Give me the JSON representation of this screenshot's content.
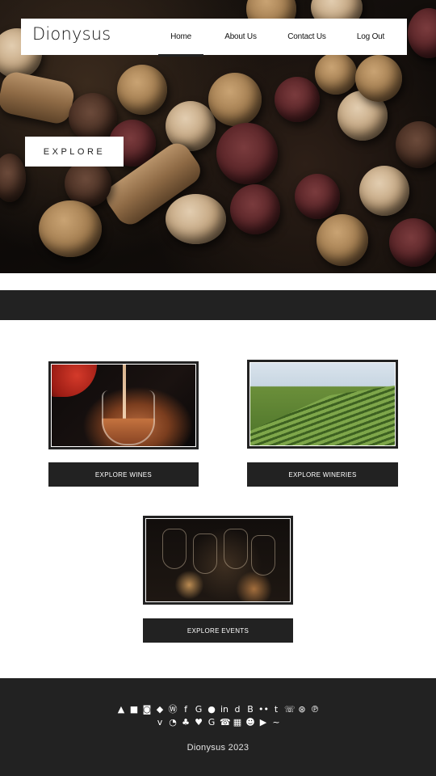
{
  "brand": {
    "name": "Dionysus"
  },
  "nav": [
    {
      "label": "Home",
      "active": true
    },
    {
      "label": "About Us",
      "active": false
    },
    {
      "label": "Contact Us",
      "active": false
    },
    {
      "label": "Log Out",
      "active": false
    }
  ],
  "hero": {
    "button_label": "EXPLORE"
  },
  "cards": [
    {
      "image": "wine-pour-photo",
      "button_label": "EXPLORE WINES"
    },
    {
      "image": "vineyard-photo",
      "button_label": "EXPLORE WINERIES"
    },
    {
      "image": "wine-glasses-photo",
      "button_label": "EXPLORE EVENTS"
    }
  ],
  "footer": {
    "social_row_1": [
      "android",
      "blogger",
      "instagram",
      "dropbox",
      "wordpress",
      "facebook",
      "google-plus",
      "apple",
      "linkedin",
      "digg",
      "behance",
      "flickr",
      "tumblr",
      "whatsapp",
      "dribbble",
      "pinterest"
    ],
    "social_row_2": [
      "vk",
      "rss",
      "snapchat",
      "twitter",
      "google",
      "skype",
      "windows",
      "reddit",
      "youtube",
      "messenger"
    ],
    "copyright": "Dionysus 2023"
  },
  "colors": {
    "dark": "#222222",
    "white": "#ffffff"
  }
}
